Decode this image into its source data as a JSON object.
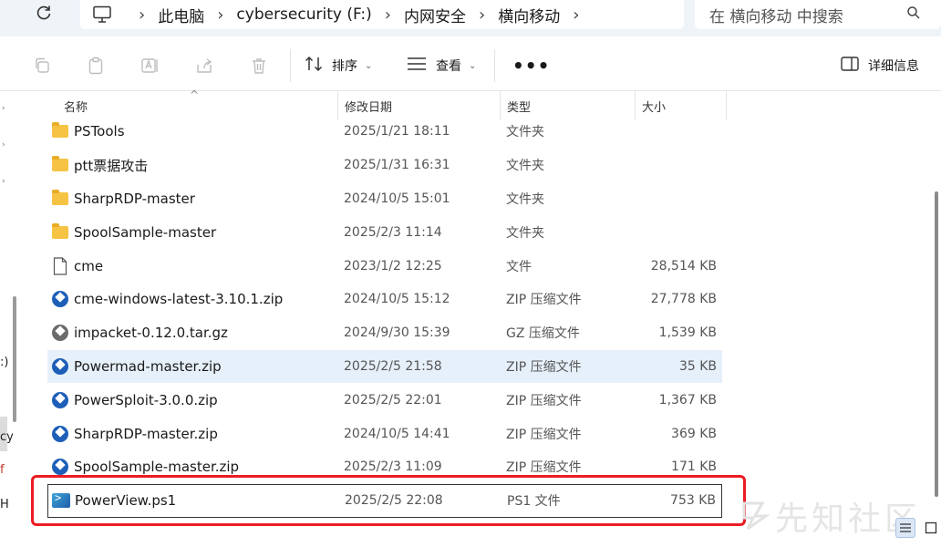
{
  "address": {
    "crumbs": [
      "此电脑",
      "cybersecurity (F:)",
      "内网安全",
      "横向移动"
    ],
    "search_placeholder": "在 横向移动 中搜索"
  },
  "toolbar": {
    "sort_label": "排序",
    "view_label": "查看",
    "more_label": "•••",
    "details_label": "详细信息"
  },
  "leftnav": {
    "labels": [
      ":)",
      "cy",
      "f",
      "H"
    ]
  },
  "columns": {
    "name": "名称",
    "date": "修改日期",
    "type": "类型",
    "size": "大小"
  },
  "files": [
    {
      "name": "PSTools",
      "date": "2025/1/21 18:11",
      "type": "文件夹",
      "size": "",
      "icon": "folder-icon"
    },
    {
      "name": "ptt票据攻击",
      "date": "2025/1/31 16:31",
      "type": "文件夹",
      "size": "",
      "icon": "folder-icon"
    },
    {
      "name": "SharpRDP-master",
      "date": "2024/10/5 15:01",
      "type": "文件夹",
      "size": "",
      "icon": "folder-icon"
    },
    {
      "name": "SpoolSample-master",
      "date": "2025/2/3 11:14",
      "type": "文件夹",
      "size": "",
      "icon": "folder-icon"
    },
    {
      "name": "cme",
      "date": "2023/1/2 12:25",
      "type": "文件",
      "size": "28,514 KB",
      "icon": "file-icon"
    },
    {
      "name": "cme-windows-latest-3.10.1.zip",
      "date": "2024/10/5 15:12",
      "type": "ZIP 压缩文件",
      "size": "27,778 KB",
      "icon": "zip-archive-icon"
    },
    {
      "name": "impacket-0.12.0.tar.gz",
      "date": "2024/9/30 15:39",
      "type": "GZ 压缩文件",
      "size": "1,539 KB",
      "icon": "gz-archive-icon"
    },
    {
      "name": "Powermad-master.zip",
      "date": "2025/2/5 21:58",
      "type": "ZIP 压缩文件",
      "size": "35 KB",
      "icon": "zip-archive-icon"
    },
    {
      "name": "PowerSploit-3.0.0.zip",
      "date": "2025/2/5 22:01",
      "type": "ZIP 压缩文件",
      "size": "1,367 KB",
      "icon": "zip-archive-icon"
    },
    {
      "name": "SharpRDP-master.zip",
      "date": "2024/10/5 14:41",
      "type": "ZIP 压缩文件",
      "size": "369 KB",
      "icon": "zip-archive-icon"
    },
    {
      "name": "SpoolSample-master.zip",
      "date": "2025/2/3 11:09",
      "type": "ZIP 压缩文件",
      "size": "171 KB",
      "icon": "zip-archive-icon"
    },
    {
      "name": "PowerView.ps1",
      "date": "2025/2/5 22:08",
      "type": "PS1 文件",
      "size": "753 KB",
      "icon": "powershell-script-icon"
    }
  ],
  "watermark": "先知社区",
  "colors": {
    "highlight": "#ec1c24",
    "hover_row": "#e6f0fa",
    "folder": "#f6c344",
    "zip": "#1d5fb8"
  }
}
